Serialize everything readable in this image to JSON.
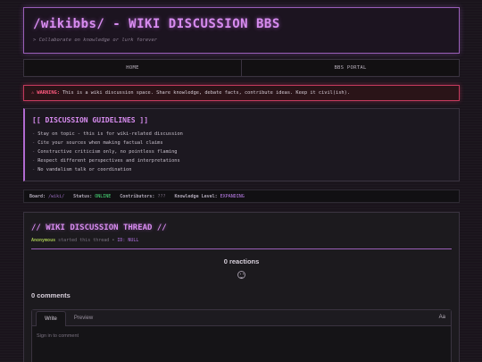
{
  "header": {
    "title": "/wikibbs/ - WIKI DISCUSSION BBS",
    "tagline": "> Collaborate on knowledge or lurk forever"
  },
  "nav": {
    "items": [
      "HOME",
      "BBS PORTAL"
    ]
  },
  "warning": {
    "label": "⚠ WARNING:",
    "text": "This is a wiki discussion space. Share knowledge, debate facts, contribute ideas. Keep it civil(ish)."
  },
  "guidelines": {
    "title": "[[ DISCUSSION GUIDELINES ]]",
    "items": [
      "Stay on topic - this is for wiki-related discussion",
      "Cite your sources when making factual claims",
      "Constructive criticism only, no pointless flaming",
      "Respect different perspectives and interpretations",
      "No vandalism talk or coordination"
    ]
  },
  "status": {
    "board_label": "Board:",
    "board_value": "/wiki/",
    "status_label": "Status:",
    "status_value": "ONLINE",
    "contributors_label": "Contributors:",
    "contributors_value": "???",
    "level_label": "Knowledge Level:",
    "level_value": "EXPANDING"
  },
  "thread": {
    "title": "// WIKI DISCUSSION THREAD //",
    "author": "Anonymous",
    "started_text": "started this thread •",
    "id_text": "ID: NULL"
  },
  "reactions": {
    "count_text": "0 reactions"
  },
  "comments": {
    "count_text": "0 comments",
    "tab_write": "Write",
    "tab_preview": "Preview",
    "format_label": "Aa",
    "placeholder": "Sign in to comment"
  },
  "colors": {
    "accent": "#d88cf0",
    "warning": "#ff5a7e",
    "online": "#4ae07a"
  }
}
